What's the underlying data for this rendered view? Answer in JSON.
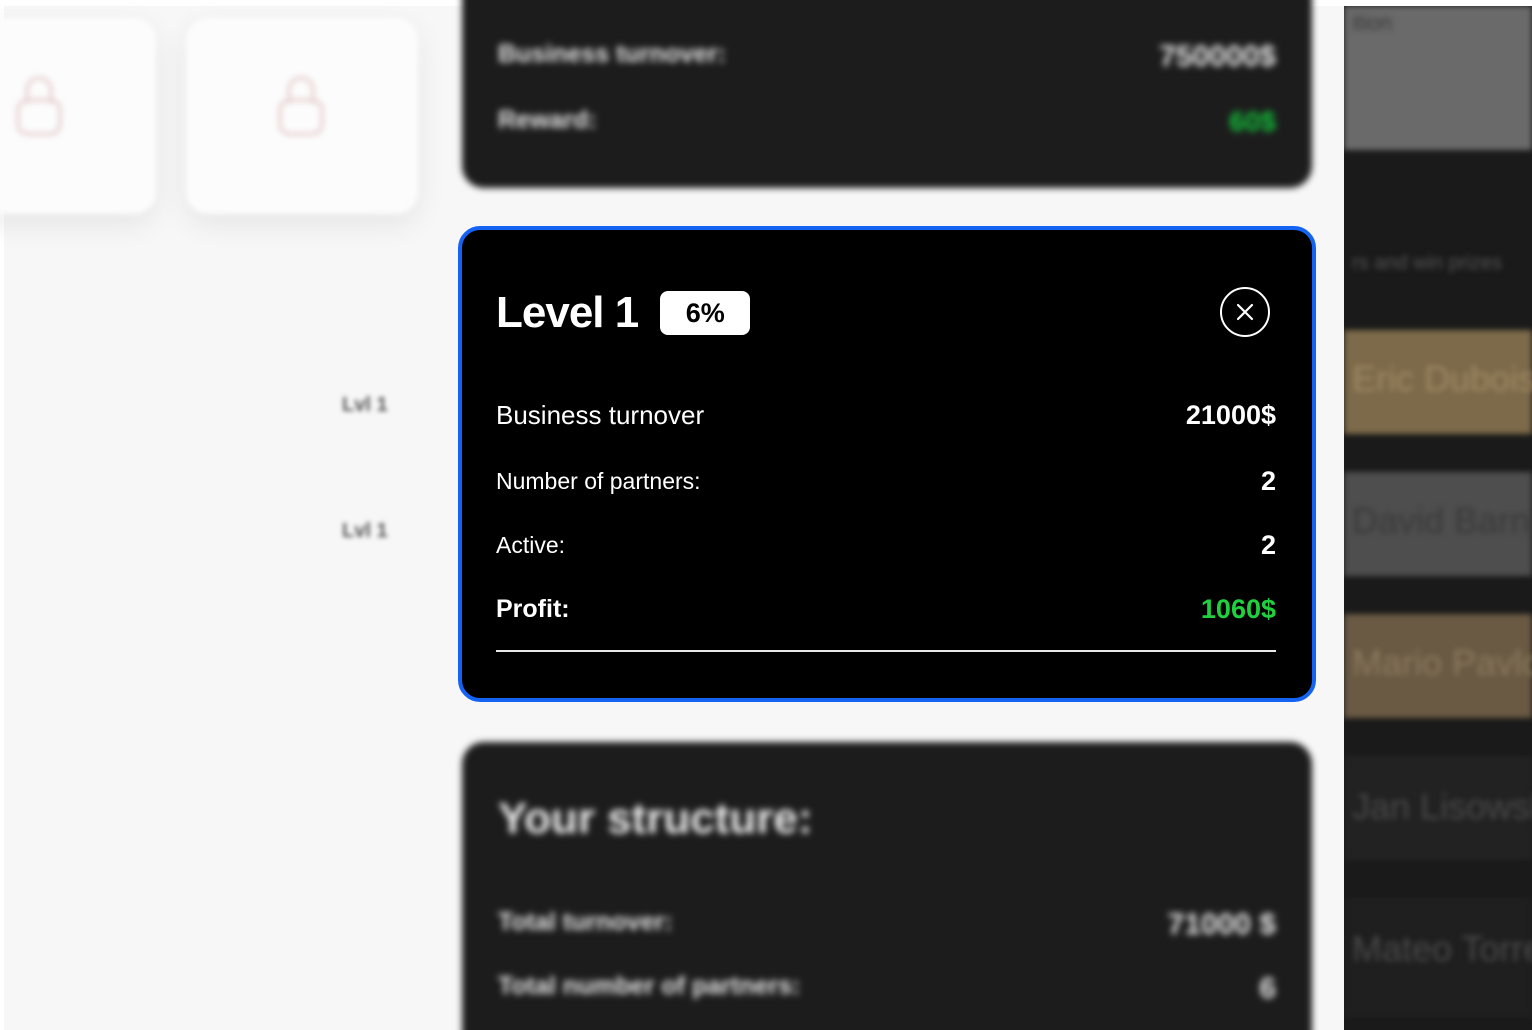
{
  "modal": {
    "title": "Level 1",
    "badge": "6%",
    "close_icon": "close-icon",
    "stats": {
      "business_turnover_label": "Business turnover",
      "business_turnover_value": "21000$",
      "partners_label": "Number of partners:",
      "partners_value": "2",
      "active_label": "Active:",
      "active_value": "2",
      "profit_label": "Profit:",
      "profit_value": "1060$"
    }
  },
  "background": {
    "top_card": {
      "turnover_label": "Business turnover:",
      "turnover_value": "750000$",
      "reward_label": "Reward:",
      "reward_value": "60$"
    },
    "level_labels": [
      "Lvl 1",
      "Lvl 1"
    ],
    "structure_card": {
      "title": "Your structure:",
      "total_turnover_label": "Total turnover:",
      "total_turnover_value": "71000 $",
      "total_partners_label": "Total number of partners:",
      "total_partners_value": "6"
    },
    "right_panel": {
      "top_text": "ition",
      "subtitle": "rs and win prizes",
      "names": [
        "Eric Dubois",
        "David Barnes",
        "Mario Pavlos",
        "Jan Lisowski",
        "Mateo Torres"
      ]
    }
  },
  "colors": {
    "accent_border": "#1463f3",
    "profit_green": "#1fd13f",
    "modal_background": "#000000",
    "badge_background": "#ffffff"
  }
}
